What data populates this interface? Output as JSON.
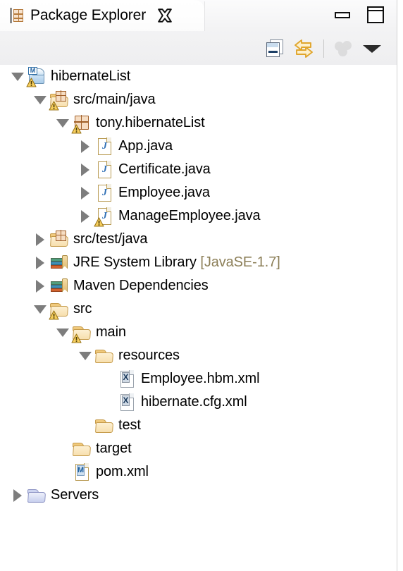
{
  "window": {
    "minimize_label": "Minimize",
    "maximize_label": "Maximize"
  },
  "tab": {
    "title": "Package Explorer",
    "icon": "package-explorer-icon",
    "close_label": "Close"
  },
  "toolbar": {
    "items": [
      {
        "name": "collapse-all-button",
        "icon": "collapse-all-icon",
        "tooltip": "Collapse All",
        "enabled": true
      },
      {
        "name": "link-with-editor-button",
        "icon": "link-with-editor-icon",
        "tooltip": "Link with Editor",
        "enabled": true
      },
      {
        "name": "focus-on-active-task-button",
        "icon": "spheres-icon",
        "tooltip": "Focus on Active Task",
        "enabled": false
      },
      {
        "name": "view-menu-button",
        "icon": "chevron-down-icon",
        "tooltip": "View Menu",
        "enabled": true
      }
    ]
  },
  "tree": {
    "rows": [
      {
        "label": "hibernateList",
        "suffix": "",
        "depth": 0,
        "twisty": "expanded",
        "icon": "java-project-icon",
        "warning": true
      },
      {
        "label": "src/main/java",
        "suffix": "",
        "depth": 1,
        "twisty": "expanded",
        "icon": "source-folder-icon",
        "warning": true
      },
      {
        "label": "tony.hibernateList",
        "suffix": "",
        "depth": 2,
        "twisty": "expanded",
        "icon": "package-icon",
        "warning": true
      },
      {
        "label": "App.java",
        "suffix": "",
        "depth": 3,
        "twisty": "collapsed",
        "icon": "java-file-icon",
        "warning": false
      },
      {
        "label": "Certificate.java",
        "suffix": "",
        "depth": 3,
        "twisty": "collapsed",
        "icon": "java-file-icon",
        "warning": false
      },
      {
        "label": "Employee.java",
        "suffix": "",
        "depth": 3,
        "twisty": "collapsed",
        "icon": "java-file-icon",
        "warning": false
      },
      {
        "label": "ManageEmployee.java",
        "suffix": "",
        "depth": 3,
        "twisty": "collapsed",
        "icon": "java-file-icon",
        "warning": true
      },
      {
        "label": "src/test/java",
        "suffix": "",
        "depth": 1,
        "twisty": "collapsed",
        "icon": "source-folder-icon",
        "warning": false
      },
      {
        "label": "JRE System Library ",
        "suffix": "[JavaSE-1.7]",
        "depth": 1,
        "twisty": "collapsed",
        "icon": "library-icon",
        "warning": false
      },
      {
        "label": "Maven Dependencies",
        "suffix": "",
        "depth": 1,
        "twisty": "collapsed",
        "icon": "library-icon",
        "warning": false
      },
      {
        "label": "src",
        "suffix": "",
        "depth": 1,
        "twisty": "expanded",
        "icon": "folder-icon",
        "warning": true
      },
      {
        "label": "main",
        "suffix": "",
        "depth": 2,
        "twisty": "expanded",
        "icon": "folder-icon",
        "warning": true
      },
      {
        "label": "resources",
        "suffix": "",
        "depth": 3,
        "twisty": "expanded",
        "icon": "folder-icon",
        "warning": false
      },
      {
        "label": "Employee.hbm.xml",
        "suffix": "",
        "depth": 4,
        "twisty": "none",
        "icon": "xml-file-icon",
        "warning": false
      },
      {
        "label": "hibernate.cfg.xml",
        "suffix": "",
        "depth": 4,
        "twisty": "none",
        "icon": "xml-file-icon",
        "warning": false
      },
      {
        "label": "test",
        "suffix": "",
        "depth": 3,
        "twisty": "none",
        "icon": "folder-icon",
        "warning": false
      },
      {
        "label": "target",
        "suffix": "",
        "depth": 2,
        "twisty": "none",
        "icon": "folder-icon",
        "warning": false
      },
      {
        "label": "pom.xml",
        "suffix": "",
        "depth": 2,
        "twisty": "none",
        "icon": "maven-file-icon",
        "warning": false
      },
      {
        "label": "Servers",
        "suffix": "",
        "depth": 0,
        "twisty": "collapsed",
        "icon": "blue-folder-icon",
        "warning": false
      }
    ]
  },
  "colors": {
    "text": "#000000",
    "dim_text": "#8c7f58",
    "folder_tan": "#f0c97c",
    "warning_yellow": "#f5c242",
    "twisty_gray": "#7d7d7d",
    "link_arrow_gold": "#e8a317"
  }
}
